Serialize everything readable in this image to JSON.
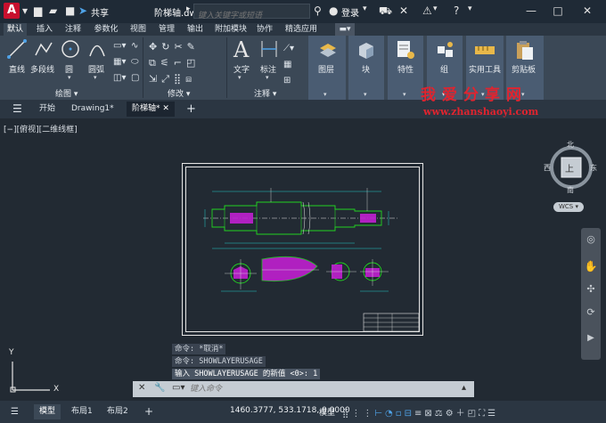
{
  "titlebar": {
    "logo": "A",
    "share": "共享",
    "document": "阶梯轴.dwg",
    "search_placeholder": "键入关键字或短语",
    "login": "登录"
  },
  "ribbon_tabs": [
    "默认",
    "插入",
    "注释",
    "参数化",
    "视图",
    "管理",
    "输出",
    "附加模块",
    "协作",
    "精选应用"
  ],
  "ribbon": {
    "draw_tools": [
      "直线",
      "多段线",
      "圆",
      "圆弧"
    ],
    "draw_panel": "绘图",
    "modify_panel": "修改",
    "text_tools": [
      "文字",
      "标注"
    ],
    "annotation_panel": "注释",
    "layers": "图层",
    "block": "块",
    "properties": "特性",
    "group": "组",
    "utilities": "实用工具",
    "clipboard": "剪贴板"
  },
  "filetabs": {
    "start": "开始",
    "drawing1": "Drawing1*",
    "active": "阶梯轴*"
  },
  "watermark": {
    "cn": "我爱分享网",
    "url": "www.zhanshaoyi.com"
  },
  "viewport": {
    "label": "[−][俯视][二维线框]"
  },
  "viewcube": {
    "north": "北",
    "south": "南",
    "east": "东",
    "west": "西",
    "top": "上",
    "wcs": "WCS"
  },
  "ucs": {
    "x": "X",
    "y": "Y"
  },
  "command_history": [
    "命令: *取消*",
    "命令: SHOWLAYERUSAGE",
    "输入 SHOWLAYERUSAGE 的新值 <0>: 1"
  ],
  "command_placeholder": "键入命令",
  "statusbar": {
    "tabs": [
      "模型",
      "布局1",
      "布局2"
    ],
    "coords": "1460.3777, 533.1718, 0.0000",
    "mode": "模型"
  },
  "colors": {
    "accent_red": "#c8102e",
    "drawing_green": "#22d322",
    "drawing_magenta": "#c020d0",
    "drawing_cyan": "#22c8c8"
  }
}
